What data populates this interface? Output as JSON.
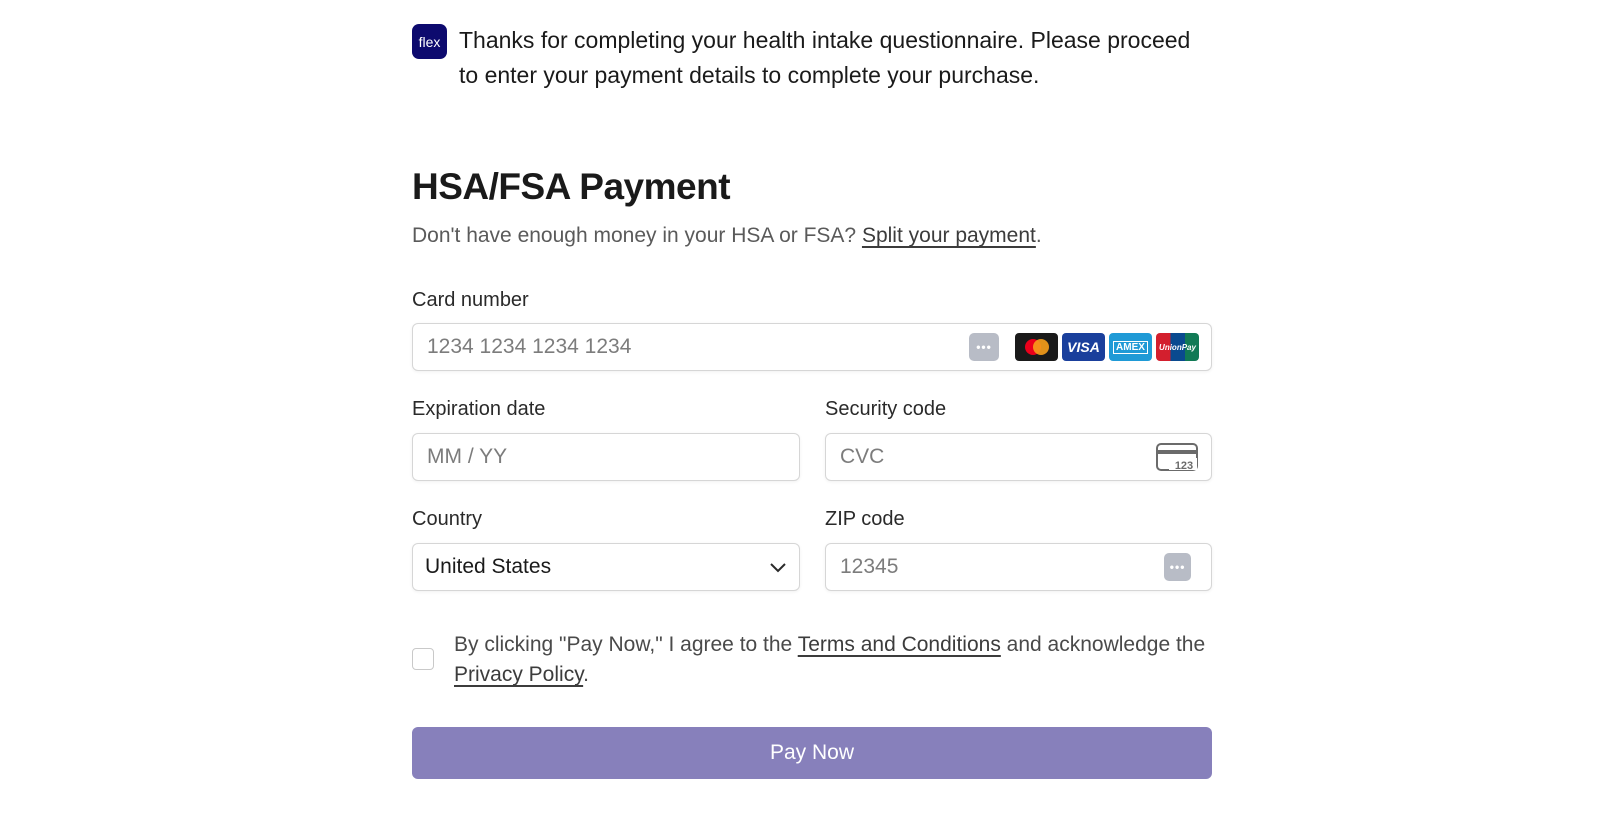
{
  "intro": {
    "logo_text": "flex",
    "message": "Thanks for completing your health intake questionnaire. Please proceed to enter your payment details to complete your purchase."
  },
  "payment": {
    "title": "HSA/FSA Payment",
    "subtitle_prefix": "Don't have enough money in your HSA or FSA?",
    "split_link": "Split your payment",
    "subtitle_suffix": "."
  },
  "form": {
    "card_number": {
      "label": "Card number",
      "placeholder": "1234 1234 1234 1234"
    },
    "expiration": {
      "label": "Expiration date",
      "placeholder": "MM / YY"
    },
    "security": {
      "label": "Security code",
      "placeholder": "CVC",
      "icon_text": "123"
    },
    "country": {
      "label": "Country",
      "value": "United States"
    },
    "zip": {
      "label": "ZIP code",
      "placeholder": "12345"
    }
  },
  "card_brands": {
    "visa": "VISA",
    "amex": "AMEX",
    "unionpay": "UnionPay"
  },
  "terms": {
    "prefix": "By clicking \"Pay Now,\" I agree to the",
    "terms_link": "Terms and Conditions",
    "middle": "and acknowledge the",
    "privacy_link": "Privacy Policy",
    "suffix": "."
  },
  "pay_button": {
    "label": "Pay Now"
  },
  "colors": {
    "brand_logo": "#0d0a6e",
    "pay_button": "#8780bb",
    "mastercard_bg": "#1a1a1a",
    "visa_bg": "#1a3f9c",
    "amex_bg": "#1f9ad6",
    "unionpay_red": "#d31f2e"
  }
}
